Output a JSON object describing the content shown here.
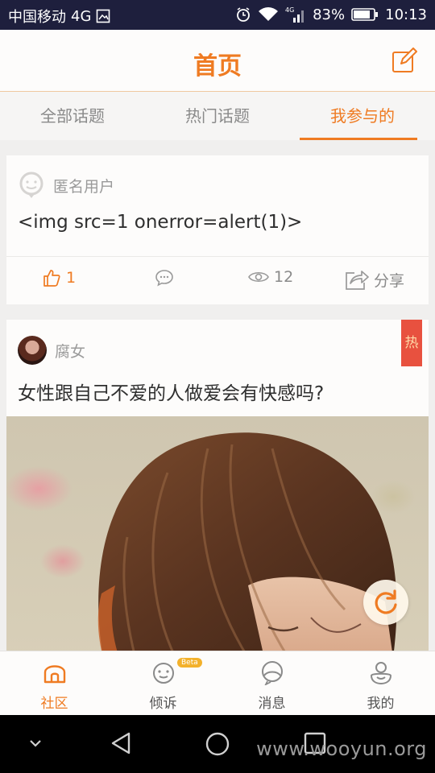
{
  "status_bar": {
    "carrier": "中国移动",
    "network": "4G",
    "battery": "83%",
    "time": "10:13",
    "icons": [
      "image-icon",
      "alarm-icon",
      "wifi-icon",
      "signal-icon",
      "battery-icon"
    ]
  },
  "header": {
    "title": "首页",
    "compose_icon": "edit-icon"
  },
  "tabs": [
    {
      "label": "全部话题",
      "active": false
    },
    {
      "label": "热门话题",
      "active": false
    },
    {
      "label": "我参与的",
      "active": true
    }
  ],
  "posts": [
    {
      "author": "匿名用户",
      "text": "<img src=1 onerror=alert(1)>",
      "likes": "1",
      "views": "12",
      "share_label": "分享"
    },
    {
      "author": "腐女",
      "title": "女性跟自己不爱的人做爱会有快感吗?",
      "hot_badge": "热"
    }
  ],
  "bottom_nav": [
    {
      "label": "社区",
      "icon": "home-icon",
      "active": true
    },
    {
      "label": "倾诉",
      "icon": "face-icon",
      "badge": "Beta"
    },
    {
      "label": "消息",
      "icon": "chat-bubble-icon"
    },
    {
      "label": "我的",
      "icon": "profile-icon"
    }
  ],
  "watermark": "www.wooyun.org",
  "colors": {
    "accent": "#ef7b22",
    "status_bar": "#1e1f3d",
    "hot": "#e8513f"
  }
}
